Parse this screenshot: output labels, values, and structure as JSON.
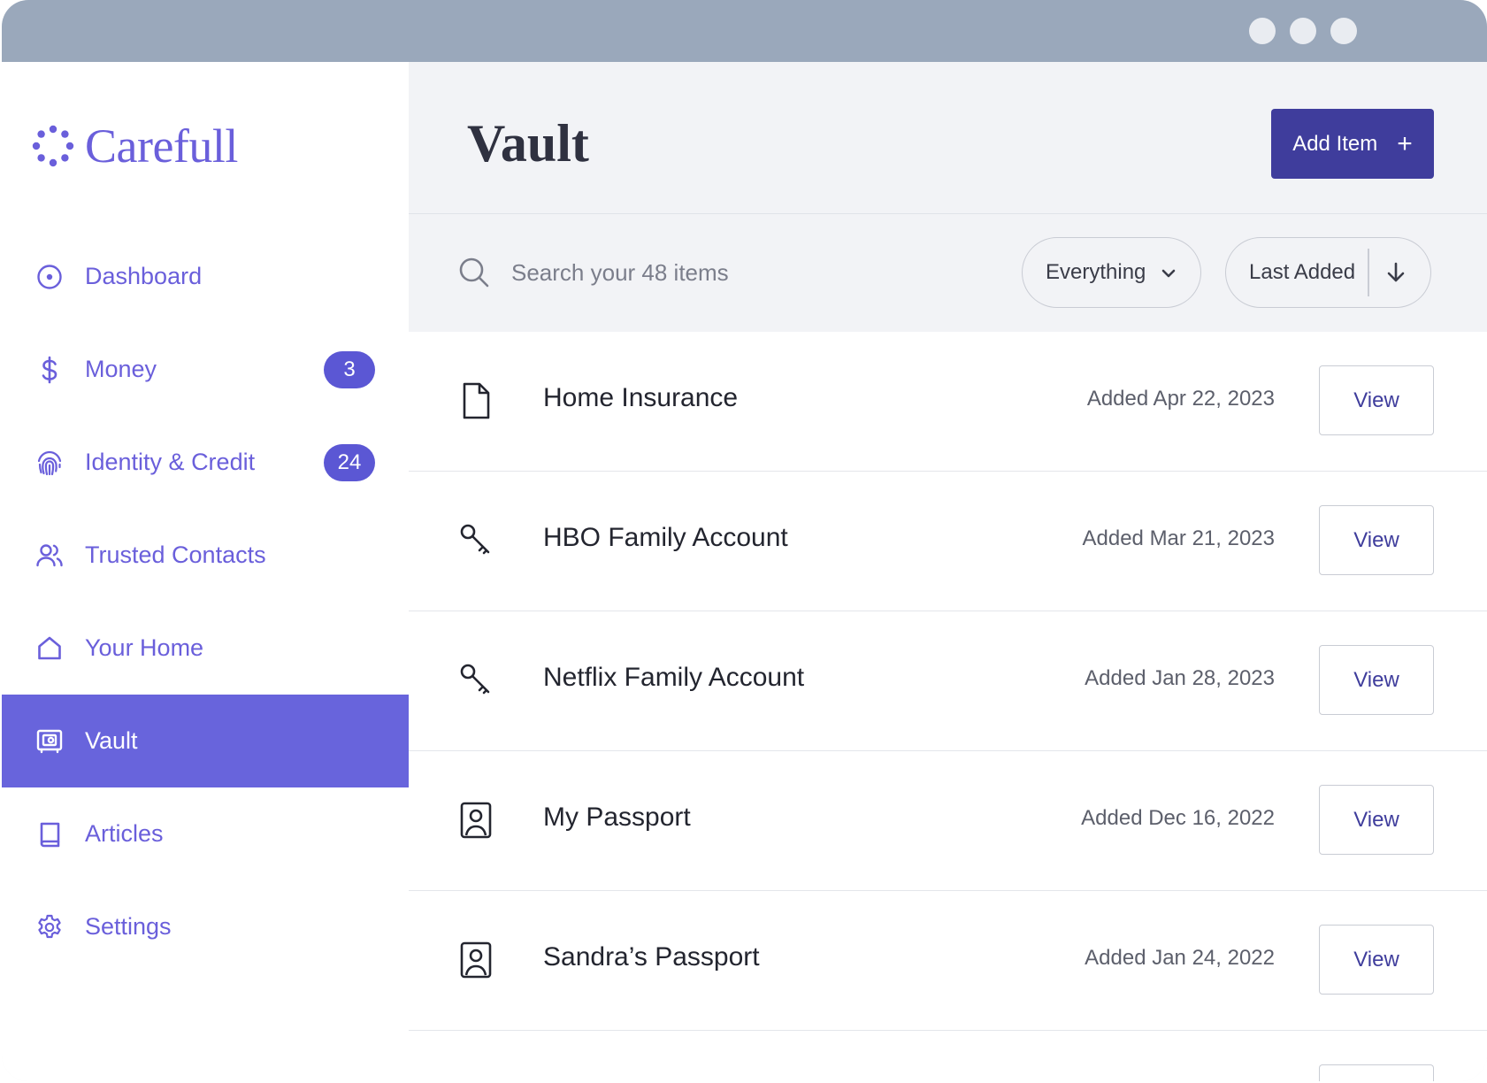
{
  "colors": {
    "accent": "#6a5fdb",
    "active_nav": "#6864dc",
    "primary_button": "#3f3d9c",
    "titlebar": "#9aa8bb"
  },
  "brand": {
    "name": "Carefull"
  },
  "sidebar": {
    "items": [
      {
        "label": "Dashboard",
        "icon": "target-icon"
      },
      {
        "label": "Money",
        "icon": "dollar-icon",
        "badge": "3"
      },
      {
        "label": "Identity & Credit",
        "icon": "fingerprint-icon",
        "badge": "24"
      },
      {
        "label": "Trusted Contacts",
        "icon": "users-icon"
      },
      {
        "label": "Your Home",
        "icon": "home-icon"
      },
      {
        "label": "Vault",
        "icon": "safe-icon",
        "active": true
      },
      {
        "label": "Articles",
        "icon": "book-icon"
      },
      {
        "label": "Settings",
        "icon": "gear-icon"
      }
    ]
  },
  "header": {
    "title": "Vault",
    "add_button": "Add Item",
    "add_icon": "+"
  },
  "toolbar": {
    "search_placeholder": "Search your 48 items",
    "filter_label": "Everything",
    "sort_label": "Last Added"
  },
  "vault_items": [
    {
      "title": "Home Insurance",
      "date": "Added Apr 22, 2023",
      "icon": "document-icon",
      "action": "View"
    },
    {
      "title": "HBO Family Account",
      "date": "Added Mar 21, 2023",
      "icon": "key-icon",
      "action": "View"
    },
    {
      "title": "Netflix Family Account",
      "date": "Added Jan 28, 2023",
      "icon": "key-icon",
      "action": "View"
    },
    {
      "title": "My Passport",
      "date": "Added Dec 16, 2022",
      "icon": "id-card-icon",
      "action": "View"
    },
    {
      "title": "Sandra’s Passport",
      "date": "Added Jan 24, 2022",
      "icon": "id-card-icon",
      "action": "View"
    }
  ]
}
